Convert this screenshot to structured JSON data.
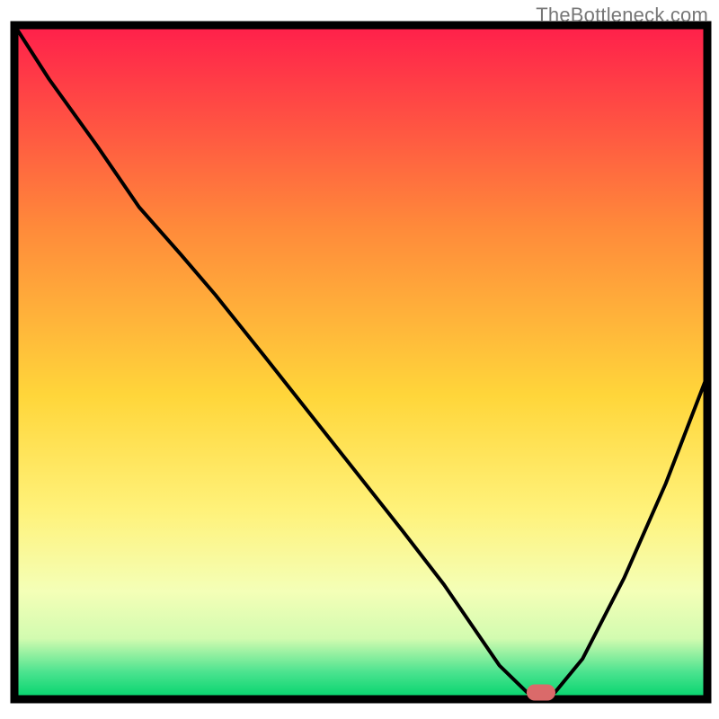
{
  "watermark": "TheBottleneck.com",
  "colors": {
    "frame": "#000000",
    "line": "#000000",
    "marker_fill": "#da6a6a",
    "marker_stroke": "#da6a6a",
    "gradient_top": "#ff1f4b",
    "gradient_mid1": "#ff8a3a",
    "gradient_mid2": "#ffd63a",
    "gradient_mid3": "#fff27a",
    "gradient_bottom_a": "#f4ffb7",
    "gradient_bottom_b": "#d2fbb0",
    "gradient_bottom_c": "#4be38f",
    "gradient_bottom_d": "#00d36b"
  },
  "chart_data": {
    "type": "line",
    "title": "",
    "xlabel": "",
    "ylabel": "",
    "xlim": [
      0,
      100
    ],
    "ylim": [
      0,
      100
    ],
    "series": [
      {
        "name": "curve",
        "x": [
          0,
          5,
          12,
          18,
          24,
          29,
          36,
          46,
          56,
          62,
          66,
          70,
          74,
          78,
          82,
          88,
          94,
          100
        ],
        "y": [
          100,
          92,
          82,
          73,
          66,
          60,
          51,
          38,
          25,
          17,
          11,
          5,
          1,
          1,
          6,
          18,
          32,
          48
        ]
      }
    ],
    "annotations": [
      {
        "name": "highlight-marker",
        "x": 76,
        "y": 1
      }
    ]
  }
}
